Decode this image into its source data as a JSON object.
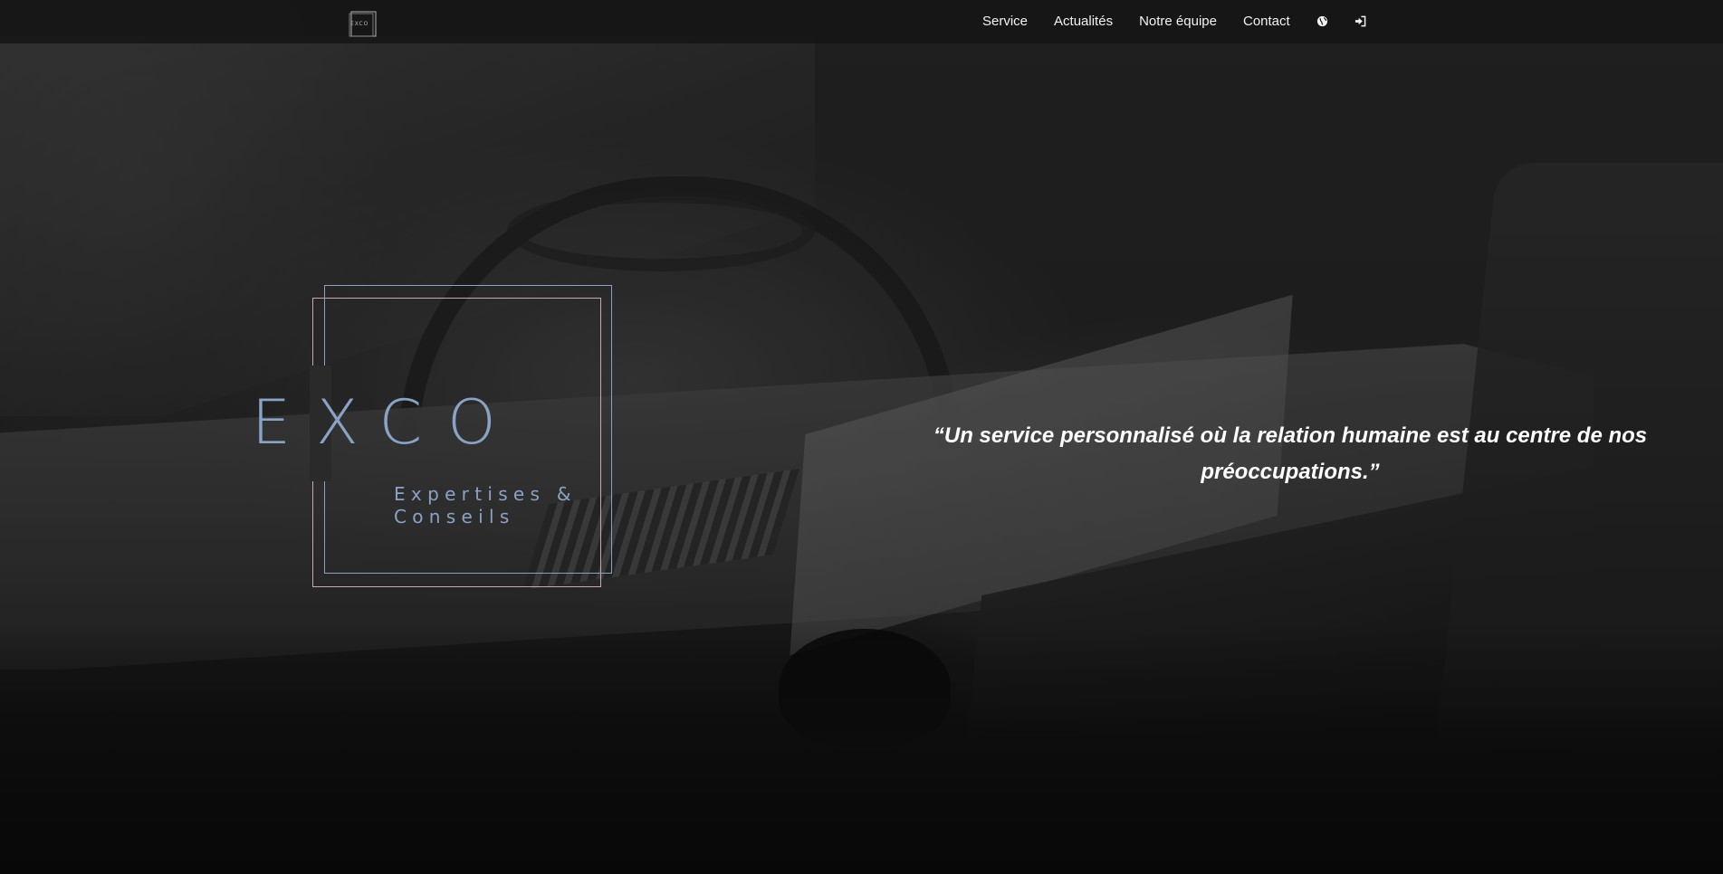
{
  "header": {
    "logo_text": "EXCO",
    "nav": [
      {
        "label": "Service"
      },
      {
        "label": "Actualités"
      },
      {
        "label": "Notre équipe"
      },
      {
        "label": "Contact"
      }
    ],
    "icons": [
      "globe-icon",
      "sign-in-icon"
    ]
  },
  "hero": {
    "logo": {
      "title": "EXCO",
      "subtitle_line1": "Expertises &",
      "subtitle_line2": "Conseils"
    },
    "quote": "“Un service personnalisé où la relation humaine est au centre de nos préoccupations.”"
  },
  "colors": {
    "logo_blue": "#8aa3c4",
    "logo_pink": "#c9a8b2",
    "navbar_bg": "#161616",
    "nav_text": "#f2f2f2"
  }
}
